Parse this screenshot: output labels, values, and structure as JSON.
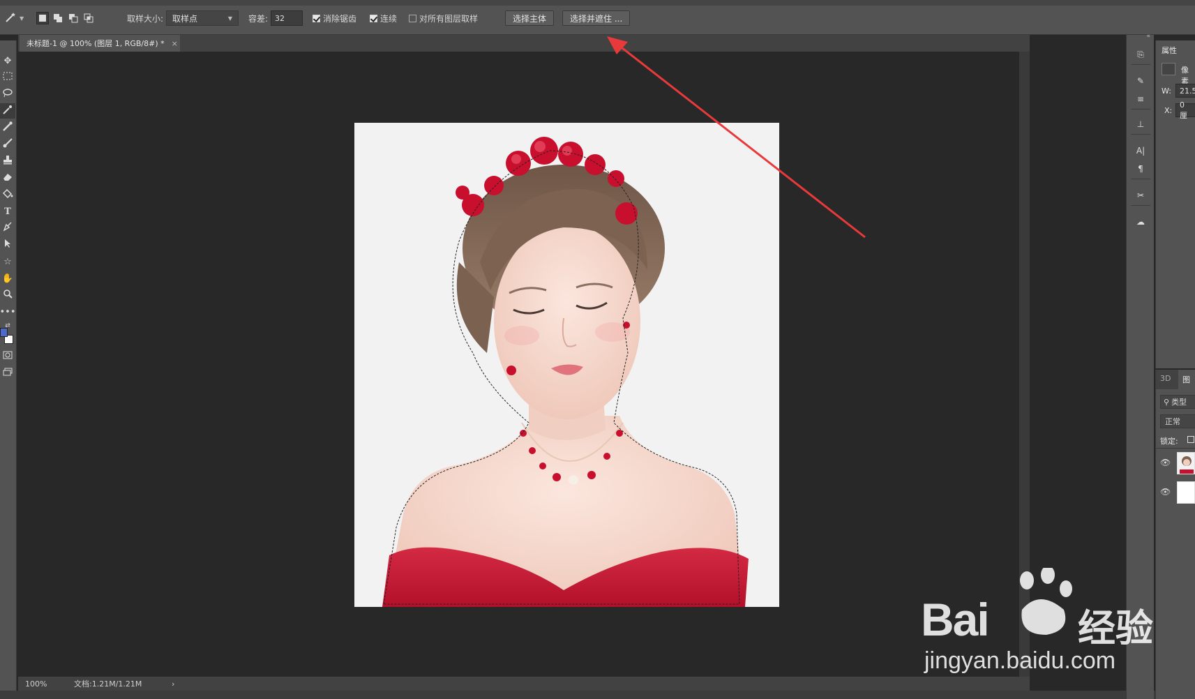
{
  "options_bar": {
    "sample_size_label": "取样大小:",
    "sample_size_value": "取样点",
    "tolerance_label": "容差:",
    "tolerance_value": "32",
    "antialias_label": "消除锯齿",
    "antialias_checked": true,
    "contiguous_label": "连续",
    "contiguous_checked": true,
    "sample_all_layers_label": "对所有图层取样",
    "sample_all_layers_checked": false,
    "select_subject_label": "选择主体",
    "select_and_mask_label": "选择并遮住 ..."
  },
  "document_tab": {
    "title": "未标题-1 @ 100% (图层 1, RGB/8#) *",
    "close": "×"
  },
  "status_bar": {
    "zoom": "100%",
    "doc_size": "文档:1.21M/1.21M",
    "arrow": "›"
  },
  "properties_panel": {
    "tab_label": "属性",
    "pixel_label": "像素",
    "w_label": "W:",
    "w_value": "21.5",
    "x_label": "X:",
    "x_value": "0 厘"
  },
  "layers_panel": {
    "tab_3d": "3D",
    "tab_layers": "图",
    "filter_label": "类型",
    "blend_mode": "正常",
    "lock_label": "锁定:"
  },
  "watermark": {
    "brand_left": "Bai",
    "brand_right": "经验",
    "url": "jingyan.baidu.com"
  },
  "colors": {
    "annotation_arrow": "#e83a3a",
    "foreground_swatch": "#4f69c8",
    "background_swatch": "#ffffff",
    "dress": "#c8102e"
  }
}
